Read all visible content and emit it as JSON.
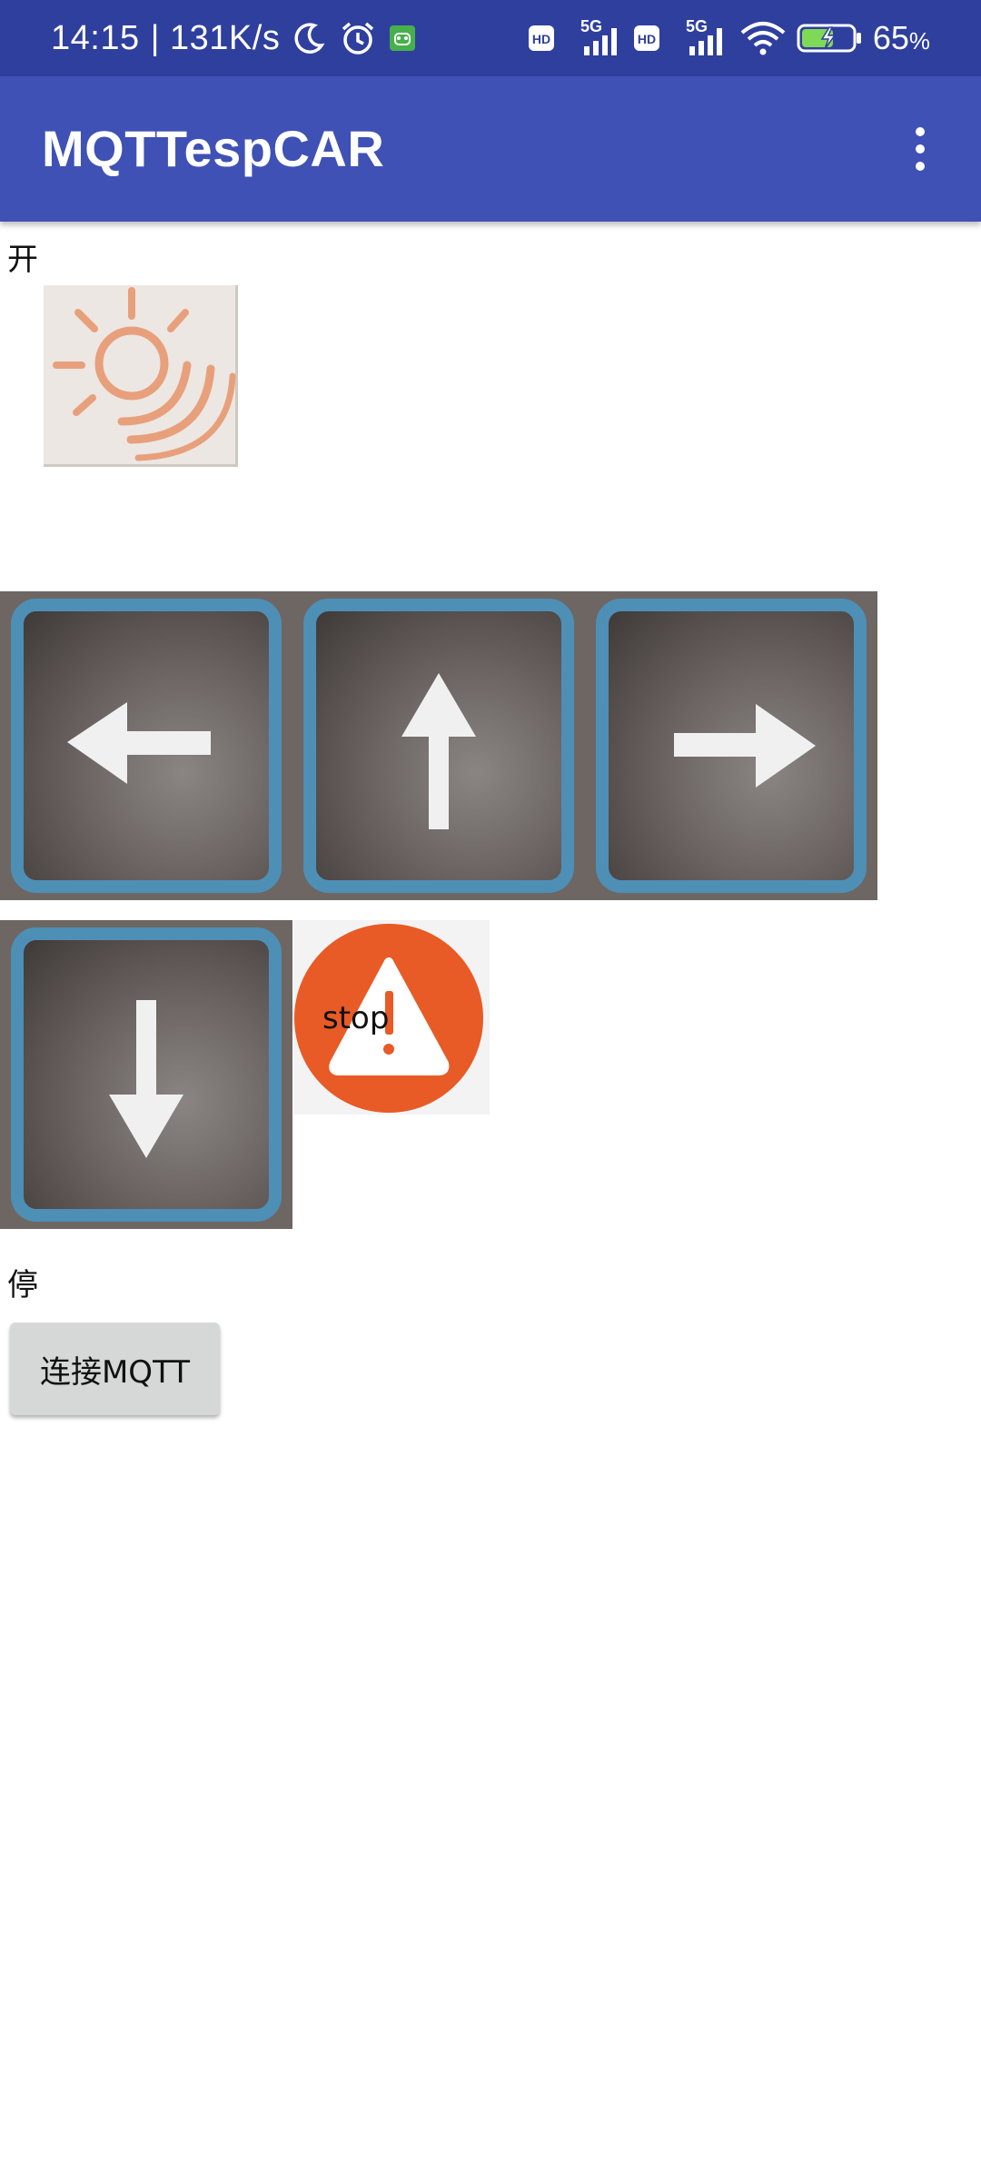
{
  "status_bar": {
    "time": "14:15",
    "speed": "| 131K/s",
    "battery_percent": "65",
    "battery_unit": "%",
    "icons": [
      "moon-icon",
      "alarm-icon",
      "android-notification-icon",
      "hd-icon",
      "cellular-5g-icon",
      "hd-icon",
      "cellular-5g-icon",
      "wifi-icon",
      "battery-charging-icon"
    ],
    "signal_labels": {
      "hd": "HD",
      "network": "5G"
    }
  },
  "app_bar": {
    "title": "MQTTespCAR",
    "menu_icon": "more-vert-icon"
  },
  "content": {
    "open_label": "开",
    "stop_label": "停",
    "light_icon": "sun-light-icon",
    "stop_button_text": "stop",
    "connect_button_label": "连接MQTT",
    "direction_buttons": [
      "arrow-left-icon",
      "arrow-up-icon",
      "arrow-right-icon",
      "arrow-down-icon"
    ]
  },
  "colors": {
    "status_bar_bg": "#2f3f9e",
    "app_bar_bg": "#3f51b5",
    "button_frame": "#4e8fb6",
    "stop_circle": "#e85a26",
    "connect_button_bg": "#d6d7d7"
  }
}
